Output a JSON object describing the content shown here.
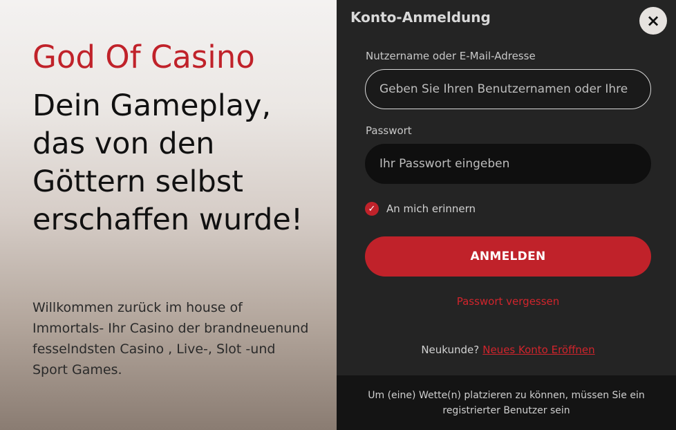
{
  "hero": {
    "brand": "God Of Casino",
    "headline": "Dein Gameplay, das von den Göttern selbst erschaffen wurde!",
    "intro": "Willkommen zurück im house of Immortals- Ihr Casino der brandneuenund fesselndsten Casino , Live-, Slot -und Sport Games."
  },
  "login": {
    "title": "Konto-Anmeldung",
    "close_icon": "×",
    "username_label": "Nutzername oder E-Mail-Adresse",
    "username_placeholder": "Geben Sie Ihren Benutzernamen oder Ihre",
    "username_value": "",
    "password_label": "Passwort",
    "password_placeholder": "Ihr Passwort eingeben",
    "password_value": "",
    "remember_label": "An mich erinnern",
    "remember_checked": true,
    "check_icon": "✓",
    "submit_label": "ANMELDEN",
    "forgot_label": "Passwort vergessen",
    "signup_question": "Neukunde?",
    "signup_link": "Neues Konto Eröffnen",
    "footer_note": "Um (eine) Wette(n) platzieren zu können, müssen Sie ein registrierter Benutzer sein"
  },
  "colors": {
    "accent": "#c0222a",
    "panel": "#242424",
    "footer": "#141414"
  }
}
